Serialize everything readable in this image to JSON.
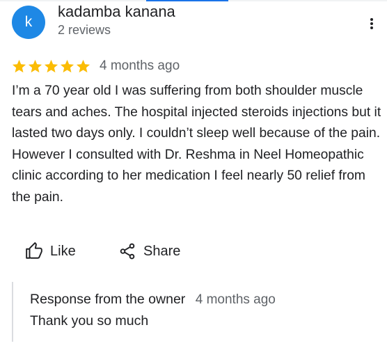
{
  "colors": {
    "avatar_bg": "#1e88e5",
    "star": "#fbbc04",
    "secondary_text": "#5f6368",
    "primary_text": "#202124"
  },
  "reviewer": {
    "avatar_letter": "k",
    "name": "kadamba kanana",
    "meta": "2 reviews"
  },
  "review": {
    "rating": 5,
    "rating_max": 5,
    "date": "4 months ago",
    "text": "I’m a 70 year old I was suffering from both shoulder muscle tears and aches. The hospital injected steroids injections but it lasted two days only. I couldn’t sleep well because of the pain. However I consulted with Dr. Reshma in Neel Homeopathic clinic according to her medication I feel nearly 50 relief from the pain."
  },
  "actions": {
    "like_label": "Like",
    "like_icon": "thumb-up-icon",
    "share_label": "Share",
    "share_icon": "share-icon",
    "more_icon": "more-vert-icon"
  },
  "owner_response": {
    "title": "Response from the owner",
    "date": "4 months ago",
    "text": "Thank you so much"
  }
}
